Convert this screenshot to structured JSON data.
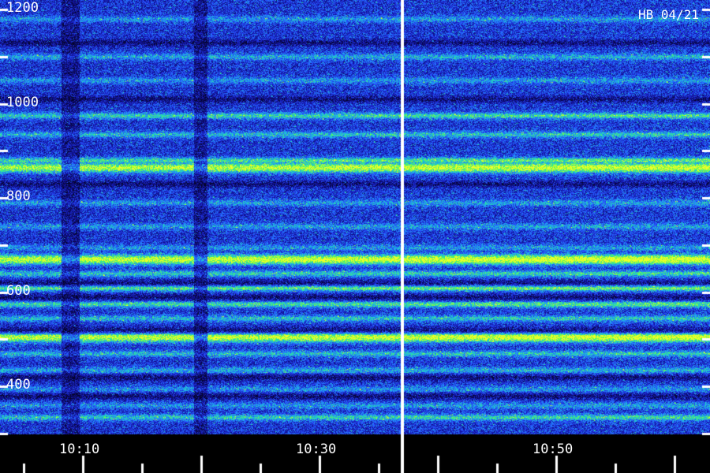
{
  "corner_label": "HB 04/21",
  "chart_data": {
    "type": "heatmap",
    "title": "",
    "xlabel": "",
    "ylabel": "",
    "y_ticks": [
      {
        "value": 1200,
        "label": "1200"
      },
      {
        "value": 1000,
        "label": "1000"
      },
      {
        "value": 800,
        "label": "800"
      },
      {
        "value": 600,
        "label": "600"
      },
      {
        "value": 400,
        "label": "400"
      }
    ],
    "ylim": [
      300,
      1220
    ],
    "x_ticks": [
      {
        "value": "10:10",
        "label": "10:10"
      },
      {
        "value": "10:30",
        "label": "10:30"
      },
      {
        "value": "10:50",
        "label": "10:50"
      }
    ],
    "xlim": [
      "10:03",
      "11:03"
    ],
    "marker_time": "10:37",
    "bands": [
      {
        "y": 1180,
        "strength": 0.3
      },
      {
        "y": 1100,
        "strength": 0.35
      },
      {
        "y": 1050,
        "strength": 0.3
      },
      {
        "y": 975,
        "strength": 0.48
      },
      {
        "y": 935,
        "strength": 0.4
      },
      {
        "y": 880,
        "strength": 0.55
      },
      {
        "y": 865,
        "strength": 0.82
      },
      {
        "y": 790,
        "strength": 0.32
      },
      {
        "y": 740,
        "strength": 0.32
      },
      {
        "y": 695,
        "strength": 0.3
      },
      {
        "y": 670,
        "strength": 0.88
      },
      {
        "y": 640,
        "strength": 0.45
      },
      {
        "y": 610,
        "strength": 0.62
      },
      {
        "y": 575,
        "strength": 0.52
      },
      {
        "y": 545,
        "strength": 0.4
      },
      {
        "y": 505,
        "strength": 0.85
      },
      {
        "y": 470,
        "strength": 0.4
      },
      {
        "y": 435,
        "strength": 0.35
      },
      {
        "y": 395,
        "strength": 0.28
      },
      {
        "y": 360,
        "strength": 0.3
      },
      {
        "y": 335,
        "strength": 0.45
      }
    ],
    "dark_gaps": [
      1130,
      1010,
      830,
      620,
      590,
      520,
      420,
      380
    ]
  }
}
